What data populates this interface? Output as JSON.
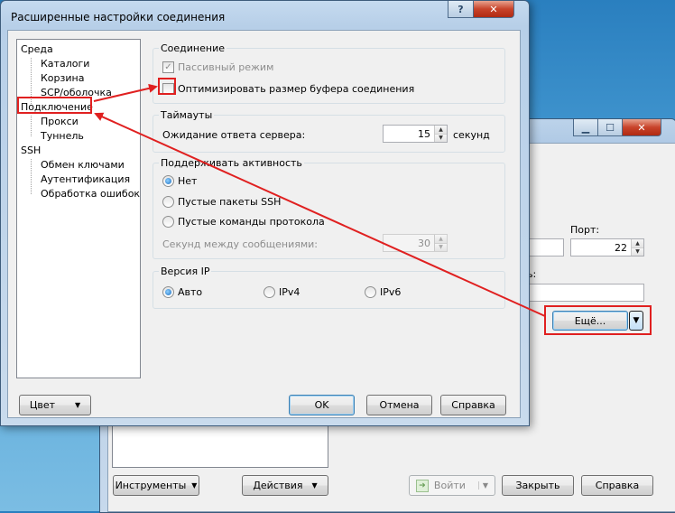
{
  "dialog": {
    "title": "Расширенные настройки соединения",
    "close_glyph": "✕",
    "help_glyph": "?",
    "tree": {
      "items": [
        {
          "label": "Среда",
          "level": 0
        },
        {
          "label": "Каталоги",
          "level": 1
        },
        {
          "label": "Корзина",
          "level": 1
        },
        {
          "label": "SCP/оболочка",
          "level": 1
        },
        {
          "label": "Подключение",
          "level": 0,
          "selected": true
        },
        {
          "label": "Прокси",
          "level": 1
        },
        {
          "label": "Туннель",
          "level": 1
        },
        {
          "label": "SSH",
          "level": 0
        },
        {
          "label": "Обмен ключами",
          "level": 1
        },
        {
          "label": "Аутентификация",
          "level": 1
        },
        {
          "label": "Обработка ошибок",
          "level": 1
        }
      ]
    },
    "connection": {
      "legend": "Соединение",
      "passive_mode": "Пассивный режим",
      "optimize_buffer": "Оптимизировать размер буфера соединения"
    },
    "timeouts": {
      "legend": "Таймауты",
      "label": "Ожидание ответа сервера:",
      "value": "15",
      "unit": "секунд"
    },
    "keepalive": {
      "legend": "Поддерживать активность",
      "options": [
        "Нет",
        "Пустые пакеты SSH",
        "Пустые команды протокола"
      ],
      "interval_label": "Секунд между сообщениями:",
      "interval_value": "30"
    },
    "ipversion": {
      "legend": "Версия IP",
      "options": [
        "Авто",
        "IPv4",
        "IPv6"
      ]
    },
    "buttons": {
      "color": "Цвет",
      "ok": "OK",
      "cancel": "Отмена",
      "help": "Справка"
    }
  },
  "background_window": {
    "min_glyph": "▁",
    "max_glyph": "☐",
    "close_glyph": "✕",
    "port_label": "Порт:",
    "port_value": "22",
    "password_label_fragment": "ль:",
    "more_button": "Ещё...",
    "buttons": {
      "tools": "Инструменты",
      "actions": "Действия",
      "login": "Войти",
      "close": "Закрыть",
      "help": "Справка"
    }
  },
  "colors": {
    "annotation": "#e02020",
    "selection_accent": "#3c7fb1"
  }
}
